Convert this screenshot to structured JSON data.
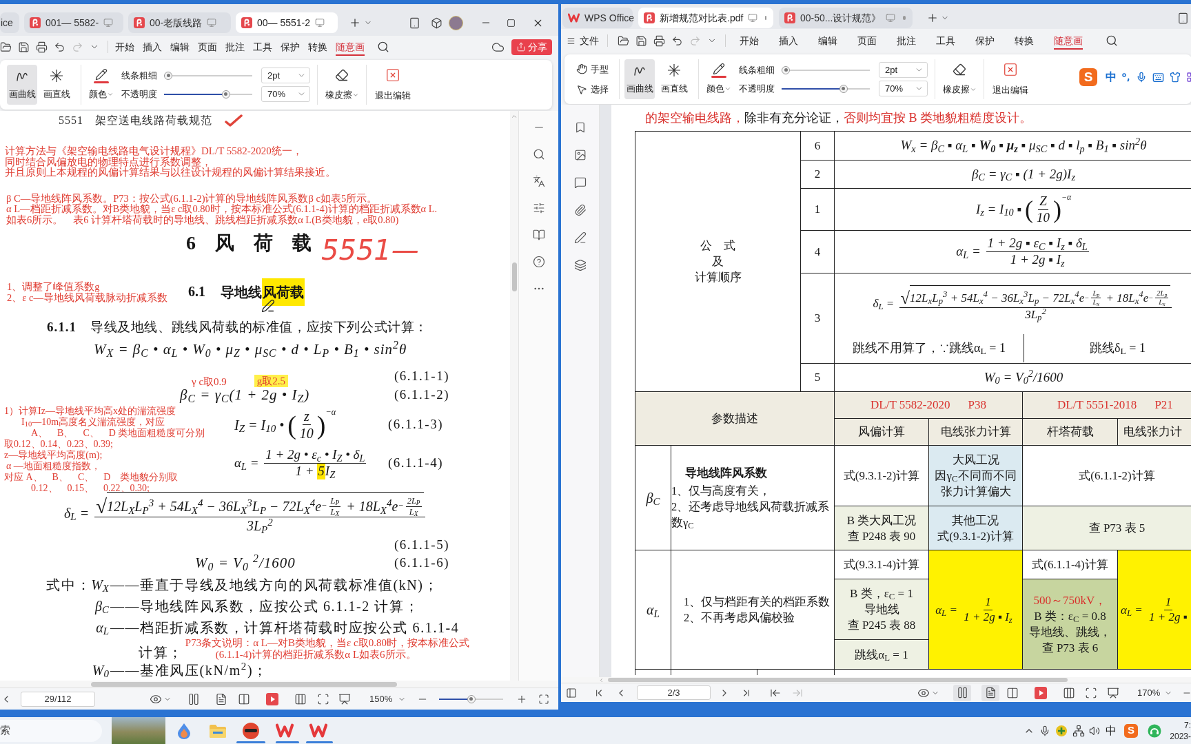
{
  "left_window": {
    "tabs": [
      {
        "label": "ice",
        "kind": "plain",
        "selected": false
      },
      {
        "label": "001— 5582-",
        "kind": "pdf",
        "selected": false
      },
      {
        "label": "00-老版线路",
        "kind": "pdf",
        "selected": false
      },
      {
        "label": "00— 5551-2",
        "kind": "pdf",
        "selected": true
      }
    ],
    "menu": [
      {
        "label": "开始",
        "selected": false
      },
      {
        "label": "插入",
        "selected": false
      },
      {
        "label": "编辑",
        "selected": false
      },
      {
        "label": "页面",
        "selected": false
      },
      {
        "label": "批注",
        "selected": false
      },
      {
        "label": "工具",
        "selected": false
      },
      {
        "label": "保护",
        "selected": false
      },
      {
        "label": "转换",
        "selected": false
      },
      {
        "label": "随意画",
        "selected": true
      }
    ],
    "share": "分享",
    "ribbon": {
      "draw_tools": [
        {
          "label": "画曲线",
          "kind": "curve",
          "selected": true
        },
        {
          "label": "画直线",
          "kind": "line",
          "selected": false
        }
      ],
      "color": {
        "label": "颜色",
        "color": "#e0393e"
      },
      "thickness": {
        "label": "线条粗细",
        "level": 0.05,
        "value": "2pt"
      },
      "opacity": {
        "label": "不透明度",
        "level": 0.7,
        "value": "70%"
      },
      "eraser": "橡皮擦",
      "exit": "退出编辑"
    },
    "document": {
      "running_head": "5551　架空送电线路荷载规范",
      "notes": [
        [
          "计算方法与《架空输电线路电气设计规程》DL/T 5582-2020统一，",
          "同时结合风偏放电的物理特点进行系数调整，",
          "并且原则上本规程的风偏计算结果与以往设计规程的风偏计算结果接近。"
        ],
        [
          "β C—导地线阵风系数。P73：按公式(6.1.1-2)计算的导地线阵风系数β c如表5所示。",
          "α L—档距折减系数。对B类地貌，当ε c取0.80时，按本标准公式(6.1.1-4)计算的档距折减系数α L.",
          "如表6所示。　表6 计算杆塔荷载时的导地线、跳线档距折减系数α L(B类地貌，e取0.80)"
        ]
      ],
      "chapter": {
        "title": "6　风　荷　载",
        "handwriting": "5551—"
      },
      "side_notes": [
        "1、调整了峰值系数g",
        "2、ε c—导地线风荷载脉动折减系数"
      ],
      "section": {
        "number": "6.1",
        "title": [
          {
            "text": "导地线",
            "highlighted": false
          },
          {
            "text": "风荷载",
            "highlighted": true
          }
        ]
      },
      "clause": {
        "number": "6.1.1",
        "text": "导线及地线、跳线风荷载的标准值，应按下列公式计算："
      },
      "inline_notes": [
        {
          "text": "γ c取0.9",
          "highlighted": false
        },
        {
          "text": "g取2.5",
          "highlighted": true
        }
      ],
      "margin_notes": [
        "1）计算Iz—导地线平均高x处的湍流强度",
        "I$_{10}$—10m高度名义湍流强度，对应",
        "A、　B、　C、　D 类地面粗糙度可分别",
        "取0.12、0.14、0.23、0.39;",
        "z—导地线平均高度(m);",
        "α —地面粗糙度指数，",
        "对应 A、　B、　C、　D　类地貌分别取",
        "0.12、　0.15、　0.22、0.30;"
      ],
      "equations": [
        {
          "number": "(6.1.1-1)",
          "parts": [
            {
              "kind": "text",
              "text": "W$_{X}$ = β$_{C}$ • α$_{L}$ • W$_{0}$ • μ$_{Z}$ • μ$_{SC}$ • d • L$_{P}$ • B$_{1}$ • sin$^{2}$θ"
            }
          ]
        },
        {
          "number": "(6.1.1-2)",
          "parts": [
            {
              "kind": "text",
              "text": "β$_{C}$ = γ$_{C}$(1 + 2g • I$_{Z}$)"
            }
          ]
        },
        {
          "number": "(6.1.1-3)",
          "parts": [
            {
              "kind": "text",
              "text": "I$_{Z}$ = I$_{10}$ • "
            },
            {
              "kind": "parens",
              "open": "(",
              "close": ")",
              "parts": [
                {
                  "kind": "fraction",
                  "num": [
                    {
                      "kind": "text",
                      "text": "z"
                    }
                  ],
                  "den": [
                    {
                      "kind": "text",
                      "text": "10"
                    }
                  ]
                }
              ]
            },
            {
              "kind": "power",
              "parts": [
                {
                  "kind": "text",
                  "text": "−α"
                }
              ]
            }
          ]
        },
        {
          "number": "(6.1.1-4)",
          "parts": [
            {
              "kind": "text",
              "text": "α$_{L}$ = "
            },
            {
              "kind": "fraction",
              "num": [
                {
                  "kind": "text",
                  "text": "1 + 2g • ε$_{c}$ • I$_{Z}$ • δ$_{L}$"
                }
              ],
              "den": [
                {
                  "kind": "text",
                  "text": "1 + "
                },
                {
                  "kind": "highlight",
                  "text": "5"
                },
                {
                  "kind": "text",
                  "text": "I$_{Z}$"
                }
              ]
            }
          ]
        },
        {
          "number": "(6.1.1-5)",
          "parts": [
            {
              "kind": "text",
              "text": "δ$_{L}$ = "
            },
            {
              "kind": "fraction",
              "num": [
                {
                  "kind": "root",
                  "sign": "√",
                  "parts": [
                    {
                      "kind": "text",
                      "text": "12L$_{X}$L$_{P}$$^{3}$ + 54L$_{X}$$^{4}$ − 36L$_{X}$$^{3}$L$_{P}$ − 72L$_{X}$$^{4}$e"
                    },
                    {
                      "kind": "power",
                      "parts": [
                        {
                          "kind": "text",
                          "text": "−"
                        },
                        {
                          "kind": "fraction",
                          "num": [
                            {
                              "kind": "text",
                              "text": "L$_{P}$"
                            }
                          ],
                          "den": [
                            {
                              "kind": "text",
                              "text": "L$_{X}$"
                            }
                          ]
                        }
                      ]
                    },
                    {
                      "kind": "text",
                      "text": " + 18L$_{X}$$^{4}$e"
                    },
                    {
                      "kind": "power",
                      "parts": [
                        {
                          "kind": "text",
                          "text": "−"
                        },
                        {
                          "kind": "fraction",
                          "num": [
                            {
                              "kind": "text",
                              "text": "2L$_{P}$"
                            }
                          ],
                          "den": [
                            {
                              "kind": "text",
                              "text": "L$_{X}$"
                            }
                          ]
                        }
                      ]
                    }
                  ]
                }
              ],
              "den": [
                {
                  "kind": "text",
                  "text": "3L$_{P}$$^{2}$"
                }
              ]
            }
          ]
        },
        {
          "number": "(6.1.1-6)",
          "parts": [
            {
              "kind": "text",
              "text": "W$_{0}$ = V$_{0}$ $^{2}$/1600"
            }
          ]
        }
      ],
      "definitions": [
        {
          "lead": "式中：",
          "symbol": "W$_{X}$",
          "text": "——垂直于导线及地线方向的风荷载标准值(kN)；"
        },
        {
          "symbol": "β$_{C}$",
          "text": "——导地线阵风系数，应按公式 6.1.1-2 计算；"
        },
        {
          "symbol": "α$_{L}$",
          "text": "——档距折减系数，计算杆塔荷载时应按公式 6.1.1-4"
        }
      ],
      "continuation": {
        "text": "计算；",
        "note": [
          "P73条文说明：α L—对B类地貌，当ε c取0.80时，按本标准公式",
          "(6.1.1-4)计算的档距折减系数α L如表6所示。"
        ]
      },
      "definition_cut": {
        "symbol": "W$_{0}$",
        "text": "——基准风压(kN/m$^{2}$)；"
      }
    },
    "status_bar": {
      "page": "29/112",
      "zoom": "150%",
      "zoom_slider": {
        "level": 0.5
      }
    }
  },
  "right_window": {
    "tabs": [
      {
        "label": "WPS Office",
        "kind": "home",
        "selected": false
      },
      {
        "label": "新增规范对比表.pdf",
        "kind": "pdf",
        "selected": true
      },
      {
        "label": "00-50...设计规范》",
        "kind": "pdf",
        "selected": false
      }
    ],
    "file_menu": "文件",
    "menu": [
      {
        "label": "开始",
        "selected": false
      },
      {
        "label": "插入",
        "selected": false
      },
      {
        "label": "编辑",
        "selected": false
      },
      {
        "label": "页面",
        "selected": false
      },
      {
        "label": "批注",
        "selected": false
      },
      {
        "label": "工具",
        "selected": false
      },
      {
        "label": "保护",
        "selected": false
      },
      {
        "label": "转换",
        "selected": false
      },
      {
        "label": "随意画",
        "selected": true
      }
    ],
    "ribbon": {
      "pointer_tools": [
        {
          "label": "手型",
          "kind": "hand"
        },
        {
          "label": "选择",
          "kind": "select"
        }
      ],
      "draw_tools": [
        {
          "label": "画曲线",
          "kind": "curve",
          "selected": true
        },
        {
          "label": "画直线",
          "kind": "line",
          "selected": false
        }
      ],
      "color": {
        "label": "颜色",
        "color": "#e0393e"
      },
      "thickness": {
        "label": "线条粗细",
        "level": 0.05,
        "value": "2pt"
      },
      "opacity": {
        "label": "不透明度",
        "level": 0.7,
        "value": "70%"
      },
      "eraser": "橡皮擦",
      "exit": "退出编辑"
    },
    "ime_toolbar": {
      "logo": "S",
      "mode": "中"
    },
    "document": {
      "intro": [
        {
          "text": "的架空输电线路，",
          "color": "#d9302c"
        },
        {
          "text": "除非有充分论证，",
          "color": "#1a1a1a"
        },
        {
          "text": "否则均宜按 B 类地貌粗糙度设计。",
          "color": "#d9302c"
        }
      ],
      "formula_table": {
        "label": [
          "公　式",
          "及",
          "计算顺序"
        ],
        "rows": [
          {
            "order": "6",
            "parts": [
              {
                "kind": "text",
                "text": "W$_{x}$ = β$_{C}$ ▪ α$_{L}$ ▪ **W$_{0}$** ▪ **μ$_{z}$** ▪ μ$_{SC}$ ▪ d ▪ l$_{p}$ ▪ B$_{1}$ ▪ sin$^{2}$θ"
              }
            ]
          },
          {
            "order": "2",
            "parts": [
              {
                "kind": "text",
                "text": "β$_{C}$ = γ$_{C}$ ▪ (1 + 2g)I$_{z}$"
              }
            ]
          },
          {
            "order": "1",
            "parts": [
              {
                "kind": "text",
                "text": "I$_{z}$ = I$_{10}$ ▪ "
              },
              {
                "kind": "parens",
                "open": "(",
                "close": ")",
                "parts": [
                  {
                    "kind": "fraction",
                    "num": [
                      {
                        "kind": "text",
                        "text": "Z"
                      }
                    ],
                    "den": [
                      {
                        "kind": "text",
                        "text": "10"
                      }
                    ]
                  }
                ]
              },
              {
                "kind": "power",
                "parts": [
                  {
                    "kind": "text",
                    "text": "−α"
                  }
                ]
              }
            ]
          },
          {
            "order": "4",
            "parts": [
              {
                "kind": "text",
                "text": "α$_{L}$ = "
              },
              {
                "kind": "fraction",
                "num": [
                  {
                    "kind": "text",
                    "text": "1 + 2g ▪ ε$_{C}$ ▪ I$_{z}$ ▪ δ$_{L}$"
                  }
                ],
                "den": [
                  {
                    "kind": "text",
                    "text": "1 + 2g ▪ I$_{z}$"
                  }
                ]
              }
            ]
          },
          {
            "order": "3",
            "parts": [
              {
                "kind": "text",
                "text": "δ$_{L}$ = "
              },
              {
                "kind": "fraction",
                "num": [
                  {
                    "kind": "root",
                    "sign": "√",
                    "parts": [
                      {
                        "kind": "text",
                        "text": "12L$_{x}$L$_{p}$$^{3}$ + 54L$_{x}$$^{4}$ − 36L$_{x}$$^{3}$L$_{p}$ − 72L$_{x}$$^{4}$e"
                      },
                      {
                        "kind": "power",
                        "parts": [
                          {
                            "kind": "text",
                            "text": "−"
                          },
                          {
                            "kind": "fraction",
                            "num": [
                              {
                                "kind": "text",
                                "text": "L$_{p}$"
                              }
                            ],
                            "den": [
                              {
                                "kind": "text",
                                "text": "L$_{x}$"
                              }
                            ]
                          }
                        ]
                      },
                      {
                        "kind": "text",
                        "text": " + 18L$_{x}$$^{4}$e"
                      },
                      {
                        "kind": "power",
                        "parts": [
                          {
                            "kind": "text",
                            "text": "−"
                          },
                          {
                            "kind": "fraction",
                            "num": [
                              {
                                "kind": "text",
                                "text": "2L$_{p}$"
                              }
                            ],
                            "den": [
                              {
                                "kind": "text",
                                "text": "L$_{x}$"
                              }
                            ]
                          }
                        ]
                      }
                    ]
                  }
                ],
                "den": [
                  {
                    "kind": "text",
                    "text": "3L$_{p}$$^{2}$"
                  }
                ]
              }
            ],
            "notes": [
              "跳线不用算了，∵跳线α$_{L}$ = 1",
              "跳线δ$_{L}$ = 1"
            ]
          },
          {
            "order": "5",
            "parts": [
              {
                "kind": "text",
                "text": "W$_{0}$ = V$_{0}$$^{2}$/1600"
              }
            ]
          }
        ]
      },
      "parameter_table": {
        "header": "参数描述",
        "standards": [
          {
            "code": "DL/T 5582-2020",
            "page": "P38",
            "columns": [
              "风偏计算",
              "电线张力计算"
            ]
          },
          {
            "code": "DL/T 5551-2018",
            "page": "P21",
            "columns": [
              "杆塔荷载",
              "电线张力计"
            ]
          }
        ],
        "rows": [
          {
            "symbol": "β$_{C}$",
            "title": "导地线阵风系数",
            "lines": [
              "1、仅与高度有关，",
              "2、还考虑导地线风荷载折减系数γ$_{C}$"
            ],
            "groups": [
              [
                {
                  "kind": "text",
                  "lines": [
                    "式(9.3.1-2)计算"
                  ],
                  "color": "#ffffff"
                },
                {
                  "kind": "text",
                  "lines": [
                    "B 类大风工况",
                    "查 P248 表 90"
                  ],
                  "color": "#eef1e3"
                }
              ],
              [
                {
                  "kind": "text",
                  "lines": [
                    "大风工况",
                    "因γ$_{C}$不同而不同",
                    "张力计算偏大"
                  ],
                  "color": "#dbeaf1"
                },
                {
                  "kind": "text",
                  "lines": [
                    "其他工况",
                    "式(9.3.1-2)计算"
                  ],
                  "color": "#dbeaf1"
                }
              ],
              [
                {
                  "kind": "text",
                  "lines": [
                    "式(6.1.1-2)计算"
                  ],
                  "color": "#ffffff"
                },
                {
                  "kind": "text",
                  "lines": [
                    "查 P73 表 5"
                  ],
                  "color": "#eef1e3"
                }
              ]
            ]
          },
          {
            "symbol": "α$_{L}$",
            "lines": [
              "1、仅与档距有关的档距系数",
              "2、不再考虑风偏校验"
            ],
            "groups": [
              [
                {
                  "kind": "text",
                  "lines": [
                    "式(9.3.1-4)计算"
                  ],
                  "color": "#ffffff"
                },
                {
                  "kind": "text",
                  "lines": [
                    "B 类，ε$_{C}$ = 1",
                    "导地线",
                    "查 P245 表 88"
                  ],
                  "color": "#eef1e3"
                },
                {
                  "kind": "text",
                  "lines": [
                    "跳线α$_{L}$ = 1"
                  ],
                  "color": "#eef1e3"
                }
              ],
              [
                {
                  "kind": "formula",
                  "parts": [
                    {
                      "kind": "text",
                      "text": "α$_{L}$ = "
                    },
                    {
                      "kind": "fraction",
                      "num": [
                        {
                          "kind": "text",
                          "text": "1"
                        }
                      ],
                      "den": [
                        {
                          "kind": "text",
                          "text": "1 + 2g ▪ I$_{z}$"
                        }
                      ]
                    }
                  ],
                  "color": "#fff200"
                }
              ],
              [
                {
                  "kind": "text",
                  "lines": [
                    "式(6.1.1-4)计算"
                  ],
                  "color": "#ffffff"
                },
                {
                  "kind": "text",
                  "note": "500～750kV，",
                  "lines": [
                    "B 类：ε$_{C}$ = 0.8",
                    "导地线、跳线，",
                    "查 P73 表 6"
                  ],
                  "color": "#c7d59f"
                }
              ],
              [
                {
                  "kind": "formula",
                  "parts": [
                    {
                      "kind": "text",
                      "text": "α$_{L}$ = "
                    },
                    {
                      "kind": "fraction",
                      "num": [
                        {
                          "kind": "text",
                          "text": "1"
                        }
                      ],
                      "den": [
                        {
                          "kind": "text",
                          "text": "1 + 2g ▪"
                        }
                      ]
                    }
                  ],
                  "color": "#fff200"
                }
              ]
            ]
          }
        ]
      }
    },
    "status_bar": {
      "page": "2/3",
      "zoom": "170%"
    }
  },
  "taskbar": {
    "search": {
      "placeholder": "索"
    },
    "tray": {
      "language": "中",
      "ime_logo": "S"
    },
    "clock": {
      "time": "7:",
      "date": "2023-"
    }
  }
}
